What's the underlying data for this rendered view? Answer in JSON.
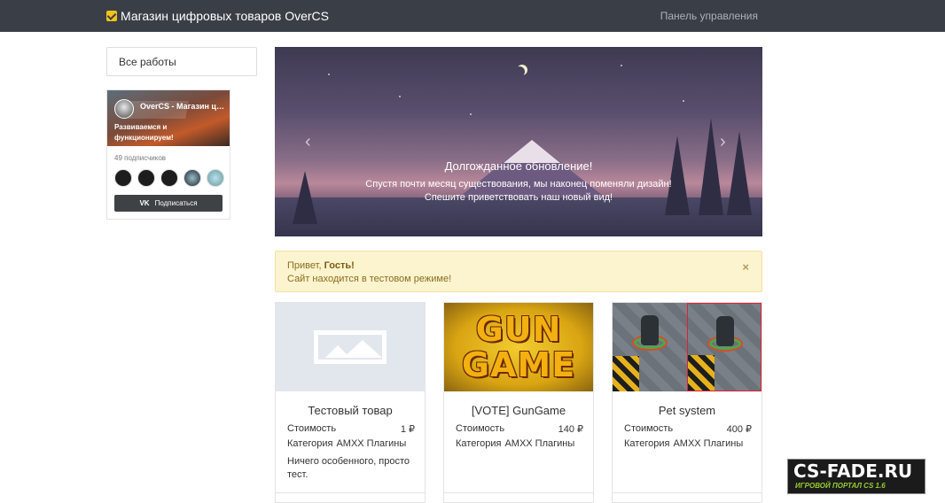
{
  "header": {
    "brand": "Магазин цифровых товаров OverCS",
    "panel_link": "Панель управления"
  },
  "sidebar": {
    "all_works": "Все работы"
  },
  "vk_widget": {
    "group_name": "OverCS - Магазин цифровых товаров",
    "description": "Развиваемся и функционируем!",
    "subscribers": "49 подписчиков",
    "subscribe_button": "Подписаться",
    "vk_logo": "VK"
  },
  "slider": {
    "title": "Долгожданное обновление!",
    "line1": "Спустя почти месяц существования, мы наконец поменяли дизайн!",
    "line2": "Спешите приветствовать наш новый вид!",
    "prev": "‹",
    "next": "›"
  },
  "alert": {
    "greeting_prefix": "Привет, ",
    "greeting_name": "Гость!",
    "message": "Сайт находится в тестовом режиме!",
    "close": "×"
  },
  "products": [
    {
      "title": "Тестовый товар",
      "price_label": "Стоимость",
      "price": "1 ₽",
      "category_label": "Категория",
      "category": "AMXX Плагины",
      "description": "Ничего особенного, просто тест."
    },
    {
      "title": "[VOTE] GunGame",
      "price_label": "Стоимость",
      "price": "140 ₽",
      "category_label": "Категория",
      "category": "AMXX Плагины",
      "image_text_1": "GUN",
      "image_text_2": "GAME"
    },
    {
      "title": "Pet system",
      "price_label": "Стоимость",
      "price": "400 ₽",
      "category_label": "Категория",
      "category": "AMXX Плагины"
    }
  ],
  "watermark": {
    "main": "CS-FADE.RU",
    "sub": "ИГРОВОЙ ПОРТАЛ CS 1.6"
  }
}
